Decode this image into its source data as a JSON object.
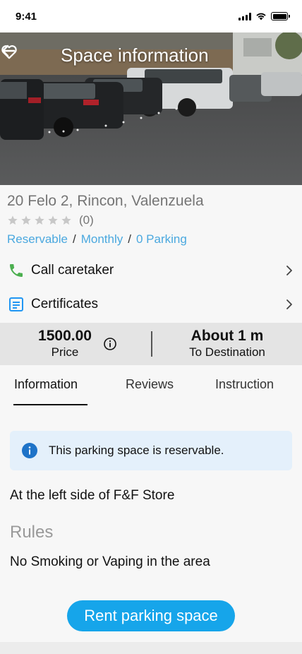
{
  "status_bar": {
    "time": "9:41"
  },
  "header": {
    "title": "Space information",
    "back_icon": "arrow-left-icon",
    "favorite_icon": "heart-outline-icon"
  },
  "space": {
    "address": "20 Felo 2, Rincon, Valenzuela",
    "rating_stars": 0,
    "rating_count": "(0)",
    "tags": [
      "Reservable",
      "Monthly",
      "0 Parking"
    ],
    "tag_separator": "/"
  },
  "actions": {
    "call_caretaker": "Call caretaker",
    "certificates": "Certificates"
  },
  "stats": {
    "price_value": "1500.00",
    "price_label": "Price",
    "distance_value": "About 1 m",
    "distance_label": "To Destination"
  },
  "tabs": [
    {
      "label": "Information",
      "active": true
    },
    {
      "label": "Reviews",
      "active": false
    },
    {
      "label": "Instruction",
      "active": false
    }
  ],
  "content": {
    "notice": "This parking space is reservable.",
    "location_description": "At the left side of F&F Store",
    "rules_heading": "Rules",
    "rules_text": "No Smoking or Vaping in the area",
    "rent_button": "Rent parking space"
  },
  "colors": {
    "accent": "#16a5ea",
    "link": "#4aa8df",
    "phone_icon": "#4caf50",
    "certificate_icon": "#2196f3",
    "notice_background": "#e4f0fb"
  }
}
